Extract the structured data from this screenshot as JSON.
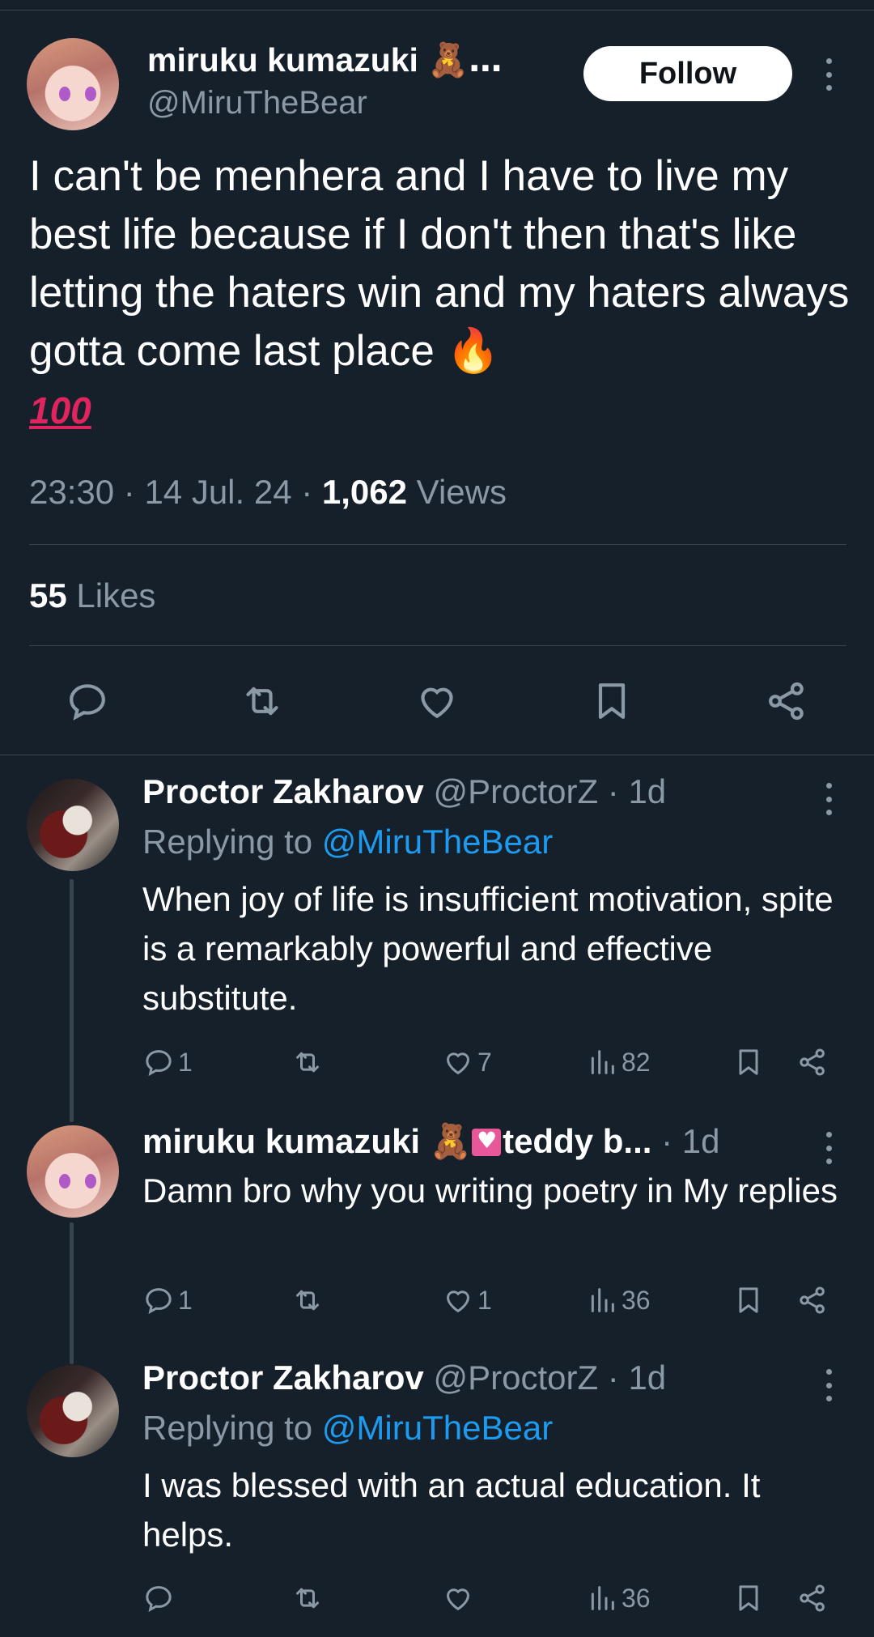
{
  "main_tweet": {
    "author_name": "miruku kumazuki",
    "author_emoji": "🧸…",
    "handle": "@MiruTheBear",
    "follow_label": "Follow",
    "text": "I can't be menhera and I have to live my best life because if I don't then that's like letting the haters win and my haters always gotta come last place",
    "text_emoji_fire": "🔥",
    "text_emoji_hundred": "100",
    "time": "23:30",
    "sep1": " · ",
    "date": "14 Jul. 24",
    "sep2": " · ",
    "views_count": "1,062",
    "views_label": " Views",
    "likes_count": "55",
    "likes_label": " Likes",
    "action_icons": [
      "reply-icon",
      "retweet-icon",
      "like-icon",
      "bookmark-icon",
      "share-icon"
    ]
  },
  "replies": [
    {
      "name": "Proctor Zakharov",
      "handle_time": " @ProctorZ · 1d",
      "replying_prefix": "Replying to ",
      "replying_handle": "@MiruTheBear",
      "text": "When joy of life is insufficient motivation, spite is a remarkably powerful and effective substitute.",
      "replies": "1",
      "retweets": "",
      "likes": "7",
      "views": "82"
    },
    {
      "name": "miruku kumazuki",
      "name_suffix": "teddy b...",
      "name_emoji": "🧸",
      "handle_time": " · 1d",
      "text": "Damn bro why you writing poetry in My replies",
      "replies": "1",
      "retweets": "",
      "likes": "1",
      "views": "36"
    },
    {
      "name": "Proctor Zakharov",
      "handle_time": " @ProctorZ · 1d",
      "replying_prefix": "Replying to ",
      "replying_handle": "@MiruTheBear",
      "text": "I was blessed with an actual education. It helps.",
      "replies": "",
      "retweets": "",
      "likes": "",
      "views": "36"
    }
  ],
  "colors": {
    "background": "#15202b",
    "muted": "#8b98a5",
    "link": "#1d9bf0",
    "divider": "#38444d"
  }
}
